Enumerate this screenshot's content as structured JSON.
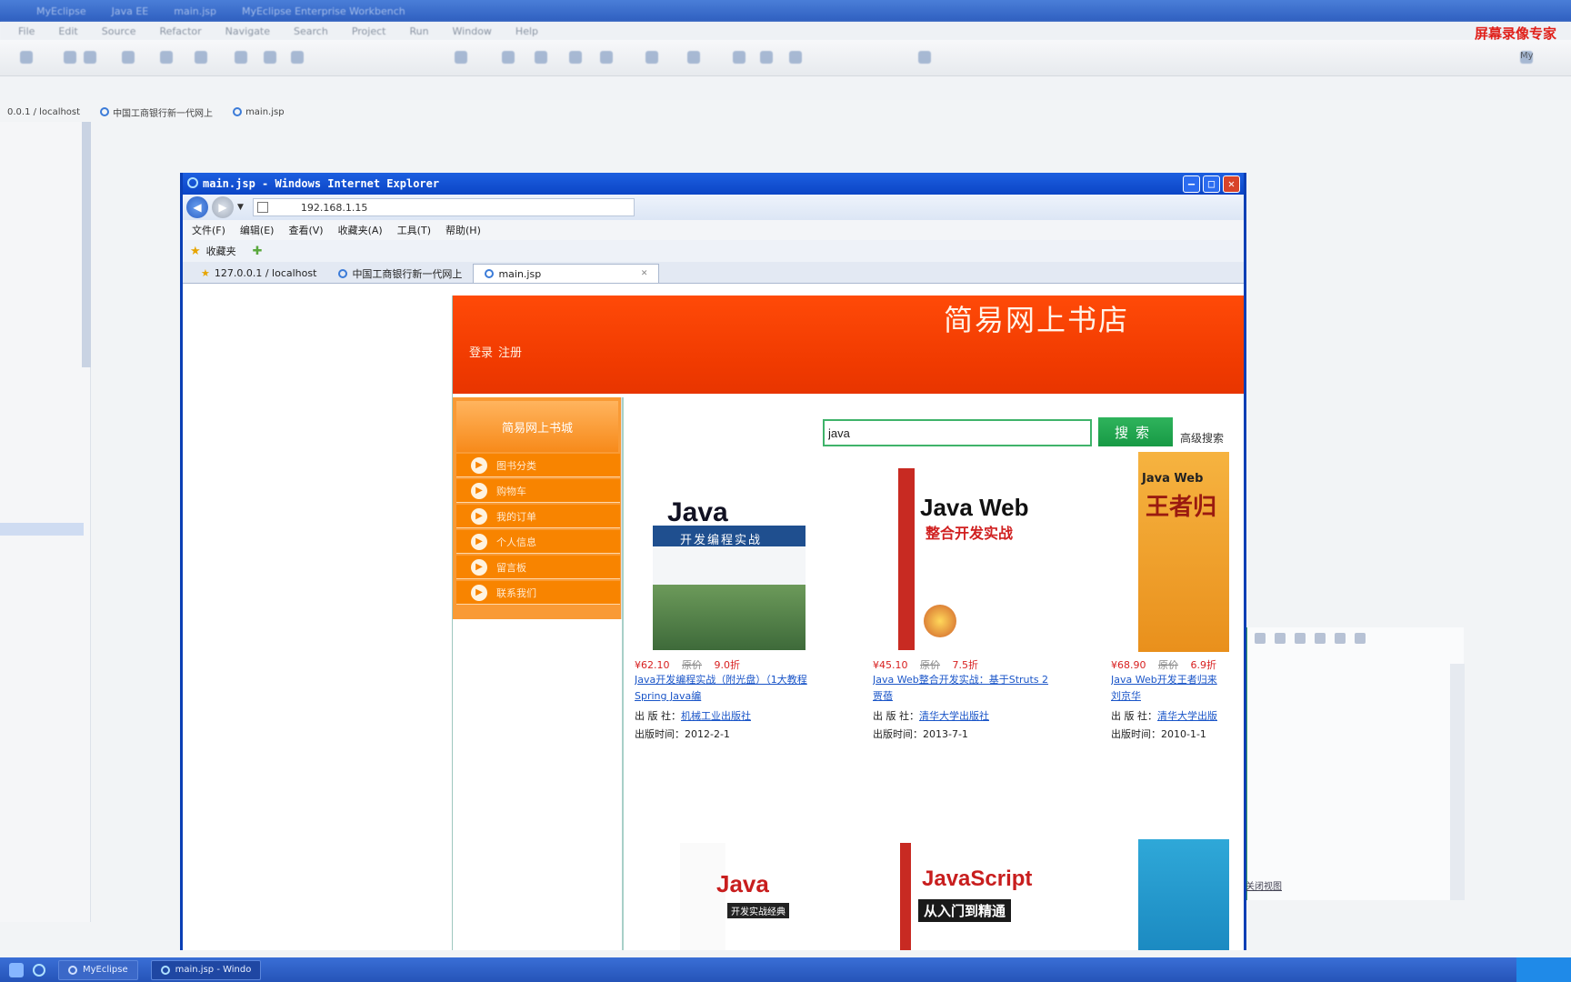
{
  "ide": {
    "title_fragments": [
      "MyEclipse",
      "Java EE",
      "main.jsp",
      "MyEclipse Enterprise Workbench"
    ],
    "menu_items": [
      "File",
      "Edit",
      "Source",
      "Refactor",
      "Navigate",
      "Search",
      "Project",
      "Run",
      "Window",
      "Help"
    ],
    "recorder_label": "屏幕录像专家",
    "recorder_mini": "My",
    "editor_tabs": [
      "0.0.1 / localhost",
      "中国工商银行新一代网上",
      "main.jsp"
    ],
    "right_panel_link": "关闭视图"
  },
  "ie": {
    "title": "main.jsp - Windows Internet Explorer",
    "address": "192.168.1.15",
    "menu": [
      "文件(F)",
      "编辑(E)",
      "查看(V)",
      "收藏夹(A)",
      "工具(T)",
      "帮助(H)"
    ],
    "favorites_label": "收藏夹",
    "tabs": [
      {
        "label": "127.0.0.1 / localhost"
      },
      {
        "label": "中国工商银行新一代网上"
      },
      {
        "label": "main.jsp"
      }
    ]
  },
  "store": {
    "site_title": "简易网上书店",
    "header_links": [
      "登录",
      "注册"
    ],
    "menu_title": "简易网上书城",
    "menu_items": [
      "图书分类",
      "购物车",
      "我的订单",
      "个人信息",
      "留言板",
      "联系我们"
    ],
    "search_value": "java",
    "search_button": "搜索",
    "advanced_search": "高级搜索",
    "books": [
      {
        "cover_title": "Java",
        "cover_sub": "开发编程实战",
        "price": "¥62.10",
        "orig": "原价",
        "discount": "9.0折",
        "title_line1": "Java开发编程实战（附光盘）（1大教程",
        "title_line2": "Spring Java编",
        "publisher_label": "出 版 社：",
        "publisher": "机械工业出版社",
        "date_label": "出版时间：",
        "date": "2012-2-1"
      },
      {
        "cover_title": "Java Web",
        "cover_sub": "整合开发实战",
        "price": "¥45.10",
        "orig": "原价",
        "discount": "7.5折",
        "title_line1": "Java Web整合开发实战：基于Struts 2",
        "title_line2": "贾蓓",
        "publisher_label": "出 版 社：",
        "publisher": "清华大学出版社",
        "date_label": "出版时间：",
        "date": "2013-7-1"
      },
      {
        "cover_title": "Java Web",
        "cover_sub": "王者归",
        "price": "¥68.90",
        "orig": "原价",
        "discount": "6.9折",
        "title_line1": "Java Web开发王者归来",
        "title_line2": "刘京华",
        "publisher_label": "出 版 社：",
        "publisher": "清华大学出版",
        "date_label": "出版时间：",
        "date": "2010-1-1"
      },
      {
        "cover_title": "Java",
        "cover_sub": "开发实战经典"
      },
      {
        "cover_title": "JavaScript",
        "cover_sub": "从入门到精通"
      },
      {
        "cover_title": "",
        "cover_sub": ""
      }
    ]
  },
  "taskbar": {
    "items": [
      "MyEclipse",
      "main.jsp - Windo"
    ]
  },
  "colors": {
    "header_orange": "#f03a00",
    "menu_orange": "#f88400",
    "search_green": "#179a45",
    "price_red": "#d82020",
    "link_blue": "#1a55c8",
    "ie_title_blue": "#0b45c6"
  }
}
